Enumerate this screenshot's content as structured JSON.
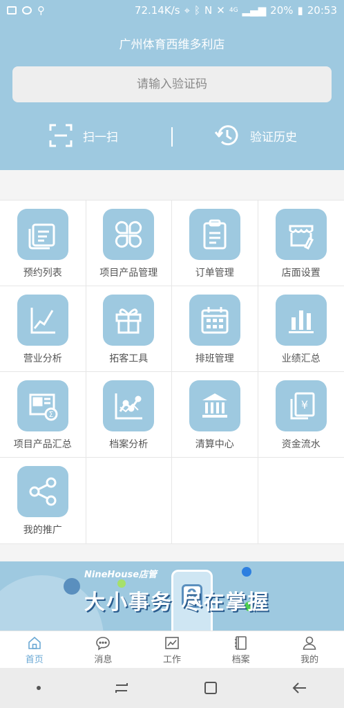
{
  "status_bar": {
    "network_speed": "72.14K/s",
    "network_type": "4G",
    "battery": "20%",
    "time": "20:53"
  },
  "header": {
    "store_name": "广州体育西维多利店",
    "code_input_placeholder": "请输入验证码",
    "scan_label": "扫一扫",
    "history_label": "验证历史"
  },
  "menu": {
    "rows": [
      [
        {
          "label": "预约列表",
          "icon": "appointment-list-icon"
        },
        {
          "label": "项目产品管理",
          "icon": "product-manage-icon"
        },
        {
          "label": "订单管理",
          "icon": "order-manage-icon"
        },
        {
          "label": "店面设置",
          "icon": "store-settings-icon"
        }
      ],
      [
        {
          "label": "营业分析",
          "icon": "business-analysis-icon"
        },
        {
          "label": "拓客工具",
          "icon": "gift-tool-icon"
        },
        {
          "label": "排班管理",
          "icon": "calendar-schedule-icon"
        },
        {
          "label": "业绩汇总",
          "icon": "bar-chart-icon"
        }
      ],
      [
        {
          "label": "项目产品汇总",
          "icon": "product-summary-icon"
        },
        {
          "label": "档案分析",
          "icon": "archive-analysis-icon"
        },
        {
          "label": "清算中心",
          "icon": "bank-icon"
        },
        {
          "label": "资金流水",
          "icon": "cash-flow-icon"
        }
      ],
      [
        {
          "label": "我的推广",
          "icon": "share-icon"
        }
      ]
    ]
  },
  "banner": {
    "brand": "NineHouse店管",
    "slogan": "大小事务 尽在掌握",
    "phone_digit": "9"
  },
  "tabbar": {
    "items": [
      {
        "label": "首页",
        "icon": "home-icon",
        "active": true
      },
      {
        "label": "消息",
        "icon": "message-icon",
        "active": false
      },
      {
        "label": "工作",
        "icon": "work-chart-icon",
        "active": false
      },
      {
        "label": "档案",
        "icon": "archive-icon",
        "active": false
      },
      {
        "label": "我的",
        "icon": "profile-icon",
        "active": false
      }
    ]
  },
  "colors": {
    "accent": "#9ec9e0",
    "active_tab": "#6aa8d4"
  }
}
